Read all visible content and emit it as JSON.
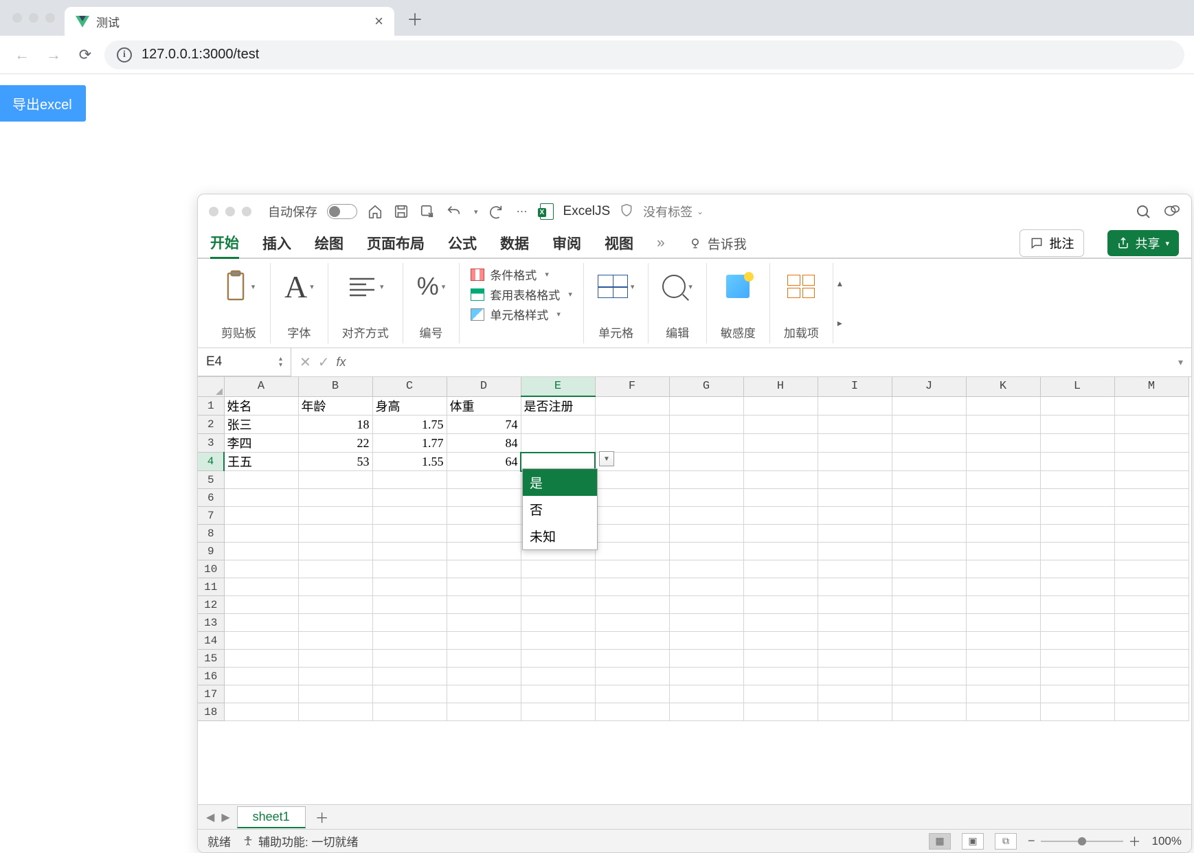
{
  "browser": {
    "tab_title": "测试",
    "url": "127.0.0.1:3000/test"
  },
  "page": {
    "export_button_label": "导出excel"
  },
  "excel": {
    "titlebar": {
      "autosave_label": "自动保存",
      "file_name": "ExcelJS",
      "tags_label": "没有标签"
    },
    "ribbon_tabs": [
      "开始",
      "插入",
      "绘图",
      "页面布局",
      "公式",
      "数据",
      "审阅",
      "视图"
    ],
    "tell_me_label": "告诉我",
    "comments_button": "批注",
    "share_button": "共享",
    "ribbon": {
      "clipboard": "剪贴板",
      "font": "字体",
      "alignment": "对齐方式",
      "number": "编号",
      "conditional_formatting": "条件格式",
      "format_as_table": "套用表格格式",
      "cell_styles": "单元格样式",
      "cells": "单元格",
      "editing": "编辑",
      "sensitivity": "敏感度",
      "addins": "加载项"
    },
    "name_box": "E4",
    "column_headers": [
      "A",
      "B",
      "C",
      "D",
      "E",
      "F",
      "G",
      "H",
      "I",
      "J",
      "K",
      "L",
      "M"
    ],
    "data_headers": [
      "姓名",
      "年龄",
      "身高",
      "体重",
      "是否注册"
    ],
    "rows": [
      {
        "name": "张三",
        "age": "18",
        "height": "1.75",
        "weight": "74"
      },
      {
        "name": "李四",
        "age": "22",
        "height": "1.77",
        "weight": "84"
      },
      {
        "name": "王五",
        "age": "53",
        "height": "1.55",
        "weight": "64"
      }
    ],
    "dropdown_options": [
      "是",
      "否",
      "未知"
    ],
    "sheet_name": "sheet1",
    "status_ready": "就绪",
    "status_accessibility": "辅助功能: 一切就绪",
    "zoom_level": "100%"
  }
}
